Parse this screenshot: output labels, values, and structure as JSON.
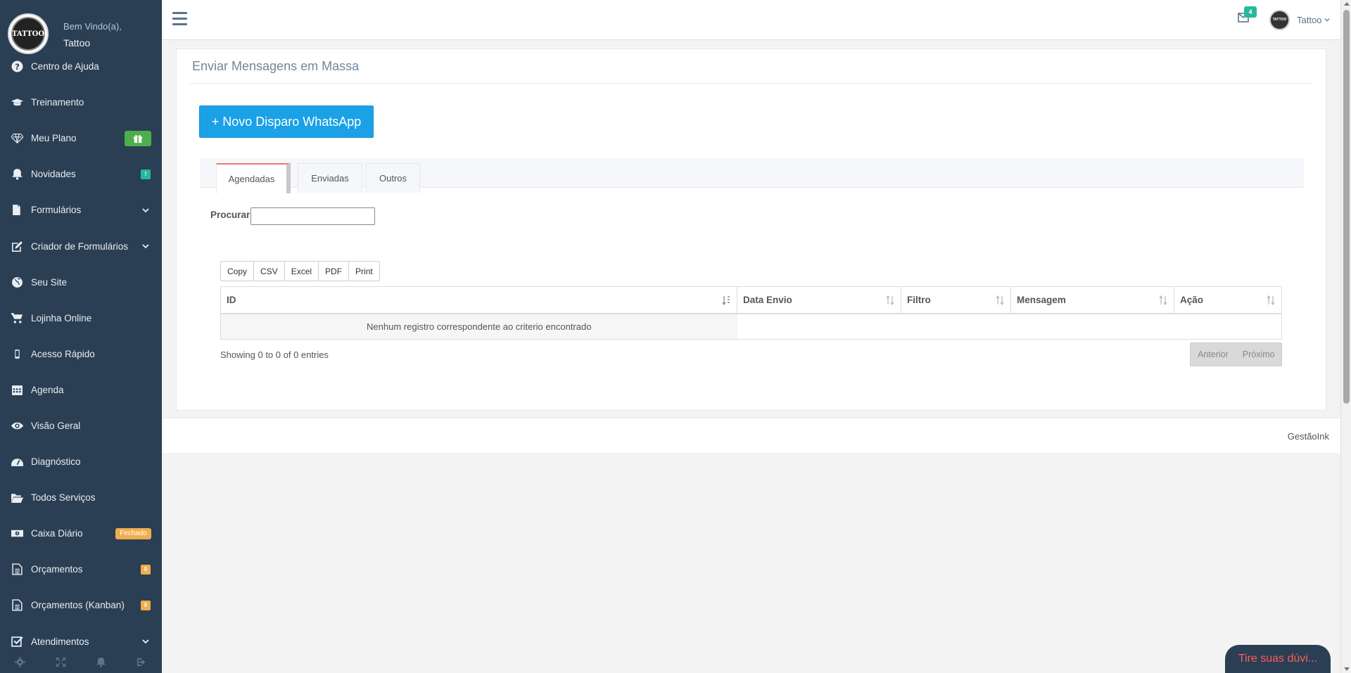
{
  "sidebar": {
    "welcome": "Bem Vindo(a),",
    "username": "Tattoo",
    "logo_text": "TATTOO",
    "items": [
      {
        "label": "Centro de Ajuda",
        "icon": "question-circle-icon"
      },
      {
        "label": "Treinamento",
        "icon": "graduation-cap-icon"
      },
      {
        "label": "Meu Plano",
        "icon": "diamond-icon",
        "badge": "gift"
      },
      {
        "label": "Novidades",
        "icon": "bell-icon",
        "badge": "!"
      },
      {
        "label": "Formulários",
        "icon": "files-icon"
      },
      {
        "label": "Criador de Formulários",
        "icon": "edit-icon"
      },
      {
        "label": "Seu Site",
        "icon": "globe-icon"
      },
      {
        "label": "Lojinha Online",
        "icon": "cart-icon"
      },
      {
        "label": "Acesso Rápido",
        "icon": "mobile-icon"
      },
      {
        "label": "Agenda",
        "icon": "calendar-icon"
      },
      {
        "label": "Visão Geral",
        "icon": "eye-icon"
      },
      {
        "label": "Diagnóstico",
        "icon": "dashboard-icon"
      },
      {
        "label": "Todos Serviços",
        "icon": "folder-open-icon"
      },
      {
        "label": "Caixa Diário",
        "icon": "money-icon",
        "badge": "Fechado"
      },
      {
        "label": "Orçamentos",
        "icon": "file-text-icon",
        "badge": "0"
      },
      {
        "label": "Orçamentos (Kanban)",
        "icon": "file-text-icon",
        "badge": "0"
      },
      {
        "label": "Atendimentos",
        "icon": "check-square-icon"
      }
    ],
    "footer_icons": [
      "gear-icon",
      "fullscreen-icon",
      "bell-icon",
      "logout-icon"
    ]
  },
  "topnav": {
    "mail_count": "4",
    "user_name": "Tattoo",
    "avatar_text": "TATTOO"
  },
  "panel": {
    "title": "Enviar Mensagens em Massa",
    "new_button": "+ Novo Disparo WhatsApp",
    "tabs": [
      {
        "label": "Agendadas",
        "active": true
      },
      {
        "label": "Enviadas",
        "active": false
      },
      {
        "label": "Outros",
        "active": false
      }
    ],
    "search_label": "Procurar",
    "search_value": "",
    "export_buttons": [
      "Copy",
      "CSV",
      "Excel",
      "PDF",
      "Print"
    ],
    "table": {
      "columns": [
        "ID",
        "Data Envio",
        "Filtro",
        "Mensagem",
        "Ação"
      ],
      "empty_message": "Nenhum registro correspondente ao criterio encontrado"
    },
    "info": "Showing 0 to 0 of 0 entries",
    "pager": {
      "previous": "Anterior",
      "next": "Próximo"
    }
  },
  "footer": {
    "brand": "GestãoInk"
  },
  "chat": {
    "label": "Tire suas dúvi..."
  },
  "colors": {
    "sidebar_bg": "#2a3f54",
    "primary_button": "#1aa1e6",
    "badge_green": "#26b99a",
    "badge_orange": "#f0ad4e",
    "chat_text": "#ff5c5c"
  }
}
